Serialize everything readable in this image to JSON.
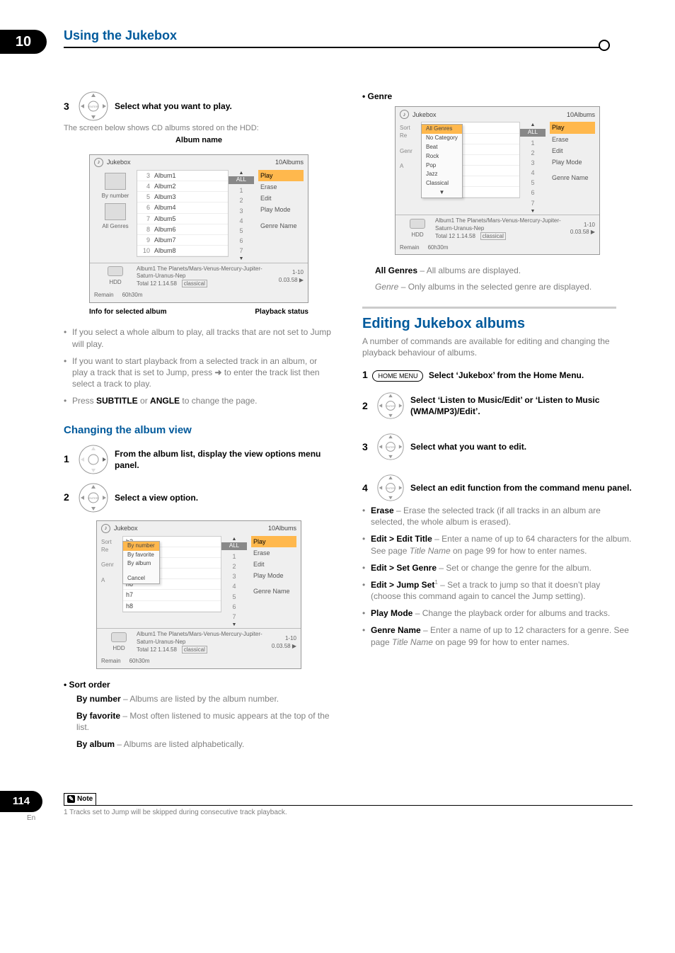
{
  "chapter_num": "10",
  "chapter_title": "Using the Jukebox",
  "left": {
    "step3": {
      "num": "3",
      "label": "Select what you want to play."
    },
    "step3_sub": "The screen below shows CD albums stored on the HDD:",
    "album_name_label": "Album name",
    "caption_left": "Info for selected album",
    "caption_right": "Playback status",
    "bullet1": "If you select a whole album to play, all tracks that are not set to Jump will play.",
    "bullet2a": "If you want to start playback from a selected track in an album, or play a track that is set to Jump, press ",
    "bullet2b": " to enter the track list then select a track to play.",
    "bullet3a": "Press ",
    "bullet3_sub": "SUBTITLE",
    "bullet3_or": " or ",
    "bullet3_ang": "ANGLE",
    "bullet3c": " to change the page.",
    "subhead_change": "Changing the album view",
    "step1": {
      "num": "1",
      "label": "From the album list, display the view options menu panel."
    },
    "step2": {
      "num": "2",
      "label": "Select a view option."
    },
    "sort_h": "Sort order",
    "sort1b": "By number",
    "sort1": " – Albums are listed by the album number.",
    "sort2b": "By favorite",
    "sort2": " – Most often listened to music appears at the top of the list.",
    "sort3b": "By album",
    "sort3": " – Albums are listed alphabetically."
  },
  "right": {
    "genre_h": "Genre",
    "genre1b": "All Genres",
    "genre1": " – All albums are displayed.",
    "genre2i": "Genre",
    "genre2": " – Only albums in the selected genre are displayed.",
    "editing_h": "Editing Jukebox albums",
    "editing_sub": "A number of commands are available for editing and changing the playback behaviour of albums.",
    "r_step1": {
      "num": "1",
      "home": "HOME MENU",
      "label": "Select ‘Jukebox’ from the Home Menu."
    },
    "r_step2": {
      "num": "2",
      "label_a": "Select ‘Listen to Music/Edit’ or ‘Listen to Music (WMA/MP3)/Edit’."
    },
    "r_step3": {
      "num": "3",
      "label": "Select what you want to edit."
    },
    "r_step4": {
      "num": "4",
      "label": "Select an edit function from the command menu panel."
    },
    "cmd": [
      {
        "b": "Erase",
        "t": " – Erase the selected track (if all tracks in an album are selected, the whole album is erased)."
      },
      {
        "b": "Edit > Edit Title",
        "t": " – Enter a name of up to 64 characters for the album. See page ",
        "i": "Title Name",
        "t2": " on page 99 for how to enter names."
      },
      {
        "b": "Edit > Set Genre",
        "t": " – Set or change the genre for the album."
      },
      {
        "b": "Edit > Jump Set",
        "sup": "1",
        "t": " – Set a track to jump so that it doesn’t play (choose this command again to cancel the Jump setting)."
      },
      {
        "b": "Play Mode",
        "t": " – Change the playback order for albums and tracks."
      },
      {
        "b": "Genre Name",
        "t": " – Enter a name of up to 12 characters for a genre. See page ",
        "i": "Title Name",
        "t2": " on page 99 for how to enter names."
      }
    ]
  },
  "ui": {
    "title": "Jukebox",
    "count": "10Albums",
    "left_a": "By number",
    "left_b": "All Genres",
    "hdd": "HDD",
    "remain": "Remain",
    "remain_t": "60h30m",
    "albums": [
      [
        "3",
        "Album1"
      ],
      [
        "4",
        "Album2"
      ],
      [
        "5",
        "Album3"
      ],
      [
        "6",
        "Album4"
      ],
      [
        "7",
        "Album5"
      ],
      [
        "8",
        "Album6"
      ],
      [
        "9",
        "Album7"
      ],
      [
        "10",
        "Album8"
      ]
    ],
    "all": "ALL",
    "nums": [
      "1",
      "2",
      "3",
      "4",
      "5",
      "6",
      "7"
    ],
    "menu": [
      "Play",
      "Erase",
      "Edit",
      "Play Mode",
      "Genre Name"
    ],
    "bottom_l": "Album1  The Planets/Mars-Venus-Mercury-Jupiter-Saturn-Uranus-Nep",
    "bottom_tag": "classical",
    "bottom_total": "Total 12  1.14.58",
    "status_a": "1-10",
    "status_b": "0.03.58",
    "popup_sort": [
      "By number",
      "By favorite",
      "By album",
      "Cancel"
    ],
    "popup_genre": [
      "All Genres",
      "No Category",
      "Beat",
      "Rock",
      "Pop",
      "Jazz",
      "Classical"
    ],
    "recs": [
      "Re",
      "Genr",
      "A"
    ],
    "recs2": [
      "Sort",
      "Re",
      "Genr",
      "A"
    ]
  },
  "note": {
    "label": "Note",
    "text": "1 Tracks set to Jump will be skipped during consecutive track playback."
  },
  "page_num": "114",
  "lang": "En"
}
